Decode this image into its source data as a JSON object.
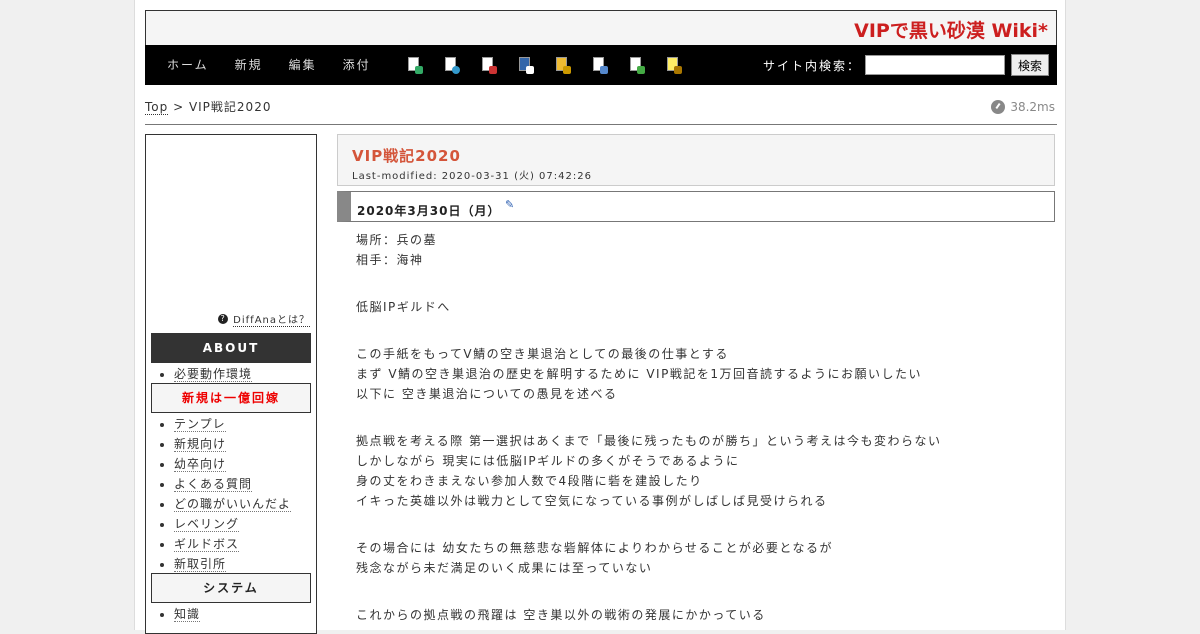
{
  "header": {
    "site_title": "VIPで黒い砂漠 Wiki*"
  },
  "nav": {
    "menu": [
      "ホーム",
      "新規",
      "編集",
      "添付"
    ],
    "icons": [
      "copy-icon",
      "rename-icon",
      "diff-icon",
      "backup-icon",
      "freeze-icon",
      "list-icon",
      "recent-icon",
      "help-icon"
    ],
    "search_label": "サイト内検索：",
    "search_value": "",
    "search_button": "検索"
  },
  "breadcrumb": {
    "top": "Top",
    "sep": " > ",
    "current": "VIP戦記2020"
  },
  "timer": "38.2ms",
  "sidebar": {
    "diffana_link": "DiffAnaとは？",
    "about_head": "ABOUT",
    "about_items": [
      "必要動作環境"
    ],
    "new_head": "新規は一億回嫁",
    "new_items": [
      "テンプレ",
      "新規向け",
      "幼卒向け",
      "よくある質問",
      "どの職がいいんだよ",
      "レベリング",
      "ギルドボス",
      "新取引所"
    ],
    "system_head": "システム",
    "system_items": [
      "知識"
    ]
  },
  "content": {
    "title": "VIP戦記2020",
    "modified": "Last-modified: 2020-03-31 (火) 07:42:26",
    "section_title": "2020年3月30日（月）",
    "lines": [
      "場所：兵の墓",
      "相手：海神",
      "",
      "低脳IPギルドへ",
      "",
      "この手紙をもってV鯖の空き巣退治としての最後の仕事とする",
      "まず V鯖の空き巣退治の歴史を解明するために VIP戦記を1万回音読するようにお願いしたい",
      "以下に 空き巣退治についての愚見を述べる",
      "",
      "拠点戦を考える際 第一選択はあくまで「最後に残ったものが勝ち」という考えは今も変わらない",
      "しかしながら 現実には低脳IPギルドの多くがそうであるように",
      "身の丈をわきまえない参加人数で4段階に砦を建設したり",
      "イキった英雄以外は戦力として空気になっている事例がしばしば見受けられる",
      "",
      "その場合には 幼女たちの無慈悲な砦解体によりわからせることが必要となるが",
      "残念ながら未だ満足のいく成果には至っていない",
      "",
      "これからの拠点戦の飛躍は 空き巣以外の戦術の発展にかかっている"
    ]
  },
  "colors": {
    "title_red": "#cc1f1f",
    "page_title": "#d4553a",
    "sb_new_red": "#e00"
  }
}
